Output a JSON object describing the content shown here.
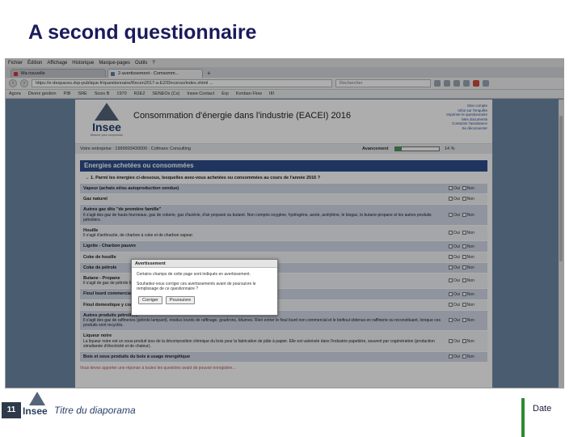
{
  "slide": {
    "title": "A second questionnaire",
    "number": "11",
    "footer_title": "Titre du diaporama",
    "date": "Date",
    "logo_text": "Insee"
  },
  "browser": {
    "menu": [
      "Fichier",
      "Édition",
      "Affichage",
      "Historique",
      "Marque-pages",
      "Outils",
      "?"
    ],
    "tabs": [
      {
        "label": "Ma nouvelle",
        "active": false
      },
      {
        "label": "2-avertissement - Comsomm...",
        "active": true
      }
    ],
    "url": "https://e-despaces.dvp-publique.fr/questionnaire/Recen2017-a-EZ/Dirconso/index.xhtml ...",
    "search_placeholder": "Rechercher",
    "bookmarks": [
      "Agora",
      "Divers gestion",
      "PIB",
      "SRE",
      "Sicex B",
      "1970",
      "R2E2",
      "SENEOs (Cs)",
      "Insee Contact",
      "Erp",
      "Konban Flow",
      "IIII"
    ]
  },
  "page": {
    "logo_text": "Insee",
    "logo_sub": "Mesurer pour comprendre",
    "survey_title": "Consommation d'énergie dans l'industrie (EACEI) 2016",
    "header_links": [
      "Mon compte",
      "Infos sur l'enquête",
      "Imprimer le questionnaire",
      "Mes documents",
      "Contacter l'assistance",
      "Se déconnecter"
    ],
    "respondent": "Votre entreprise : 1999993430000 : Cofinanc Consulting",
    "progress_label": "Avancement",
    "progress_fraction": 0.14,
    "progress_text": "14 %",
    "section_title": "Energies achetées ou consommées",
    "question": "→ 1. Parmi les énergies ci-dessous, lesquelles avez-vous achetées ou consommées au cours de l'année 2016 ?",
    "yes_label": "Oui",
    "no_label": "Non",
    "rows": [
      {
        "title": "Vapeur (achats et/ou autoproduction vendue)",
        "desc": "",
        "style": "blue"
      },
      {
        "title": "Gaz naturel",
        "desc": "",
        "style": "white"
      },
      {
        "title": "Autres gaz dits \"de première famille\"",
        "desc": "Il s'agit des gaz de hauts fourneaux, gaz de cokerie, gaz d'aciérie, d'air propané ou butané. Non compris oxygène, hydrogène, azote, acétylène, le biogaz, le butane-propane et les autres produits pétroliers.",
        "style": "blue"
      },
      {
        "title": "Houille",
        "desc": "Il s'agit d'anthracite, de charbon à coke et de charbon vapeur.",
        "style": "white"
      },
      {
        "title": "Lignite - Charbon pauvre",
        "desc": "",
        "style": "blue"
      },
      {
        "title": "Coke de houille",
        "desc": "",
        "style": "white"
      },
      {
        "title": "Coke de pétrole",
        "desc": "",
        "style": "blue"
      },
      {
        "title": "Butane - Propane",
        "desc": "Il s'agit de gaz de pétrole liquéfié hors carburants",
        "style": "white"
      },
      {
        "title": "Fioul lourd commercial",
        "desc": "",
        "style": "blue"
      },
      {
        "title": "Fioul domestique y compris gazole non routier",
        "desc": "",
        "style": "white"
      },
      {
        "title": "Autres produits pétroliers",
        "desc": "Il s'agit des gaz de raffineries (pétrole lampant), résidus lourds de raffinage, goudrons, bitumes. Rien entrer le fioul lourd non commercial et le biofioul obtenus en raffinerie ou reconstituant, lorsque ces produits sont recyclés.",
        "style": "blue"
      },
      {
        "title": "Liqueur noire",
        "desc": "La liqueur noire est un sous-produit issu de la décomposition chimique du bois pour la fabrication de pâte à papier. Elle est valorisée dans l'industrie papetière, souvent par cogénération (production simultanée d'électricité et de chaleur).",
        "style": "white"
      },
      {
        "title": "Bois et sous produits du bois à usage énergétique",
        "desc": "",
        "style": "blue"
      }
    ],
    "footnote": "Vous devez apporter une réponse à toutes les questions avant de pouvoir enregistrer..."
  },
  "dialog": {
    "title": "Avertissement",
    "line1": "Certains champs de cette page sont indiqués en avertissement.",
    "line2": "Souhaitez-vous corriger ces avertissements avant de poursuivre le remplissage de ce questionnaire ?",
    "correct_label": "Corriger",
    "continue_label": "Poursuivre"
  }
}
